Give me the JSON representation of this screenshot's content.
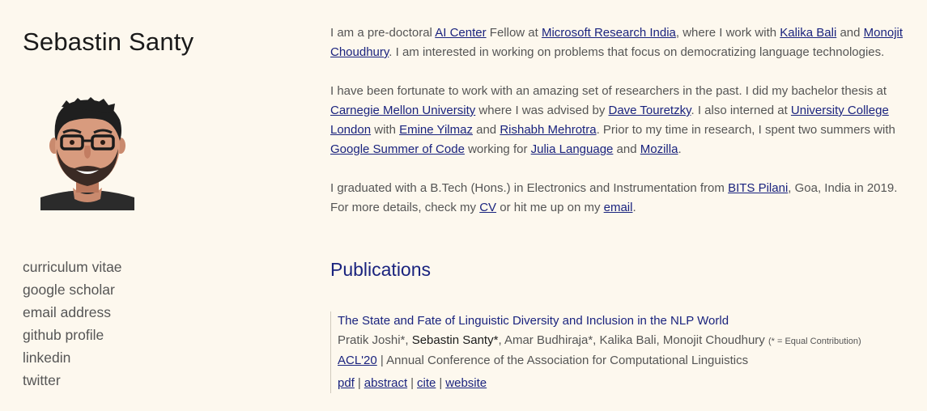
{
  "profile": {
    "name": "Sebastin Santy"
  },
  "sidebar": {
    "links": [
      "curriculum vitae",
      "google scholar",
      "email address",
      "github profile",
      "linkedin",
      "twitter"
    ]
  },
  "bio": {
    "p1": {
      "t1": "I am a pre-doctoral ",
      "l1": "AI Center",
      "t2": " Fellow at ",
      "l2": "Microsoft Research India",
      "t3": ", where I work with ",
      "l3": "Kalika Bali",
      "t4": " and ",
      "l4": "Monojit Choudhury",
      "t5": ". I am interested in working on problems that focus on democratizing language technologies."
    },
    "p2": {
      "t1": "I have been fortunate to work with an amazing set of researchers in the past. I did my bachelor thesis at ",
      "l1": "Carnegie Mellon University",
      "t2": " where I was advised by ",
      "l2": "Dave Touretzky",
      "t3": ". I also interned at ",
      "l3": "University College London",
      "t4": " with ",
      "l4": "Emine Yilmaz",
      "t5": " and ",
      "l5": "Rishabh Mehrotra",
      "t6": ". Prior to my time in research, I spent two summers with ",
      "l6": "Google Summer of Code",
      "t7": " working for ",
      "l7": "Julia Language",
      "t8": " and ",
      "l8": "Mozilla",
      "t9": "."
    },
    "p3": {
      "t1": "I graduated with a B.Tech (Hons.) in Electronics and Instrumentation from ",
      "l1": "BITS Pilani",
      "t2": ", Goa, India in 2019. For more details, check my ",
      "l2": "CV",
      "t3": " or hit me up on my ",
      "l3": "email",
      "t4": "."
    }
  },
  "publications": {
    "heading": "Publications",
    "items": [
      {
        "title": "The State and Fate of Linguistic Diversity and Inclusion in the NLP World",
        "authors_before": "Pratik Joshi*, ",
        "author_self": "Sebastin Santy*",
        "authors_after": ", Amar Budhiraja*, Kalika Bali, Monojit Choudhury ",
        "note": "(* = Equal Contribution)",
        "venue_short": "ACL'20",
        "venue_full": " | Annual Conference of the Association for Computational Linguistics",
        "links": [
          "pdf",
          "abstract",
          "cite",
          "website"
        ],
        "sep": "|"
      }
    ]
  },
  "colors": {
    "background": "#fdf8ee",
    "link": "#1a237e",
    "text": "#555555",
    "name": "#1a1a1a"
  },
  "icons": {
    "avatar": "cartoon-avatar-portrait"
  }
}
